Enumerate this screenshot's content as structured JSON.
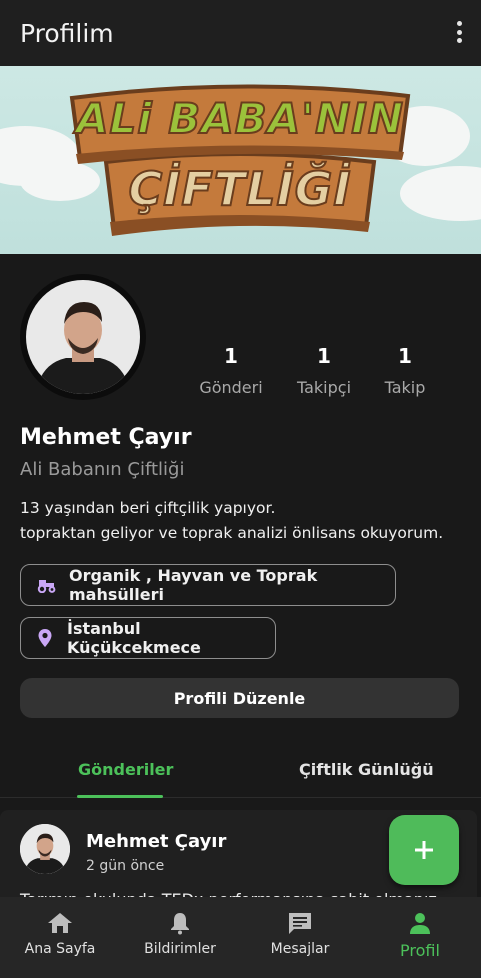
{
  "appbar": {
    "title": "Profilim"
  },
  "banner": {
    "line1": "ALi BABA'NIN",
    "line2": "ÇİFTLİĞİ"
  },
  "profile": {
    "name": "Mehmet Çayır",
    "farm": "Ali Babanın Çiftliği",
    "bio": "13 yaşından beri çiftçilik yapıyor.\ntopraktan geliyor ve toprak analizi önlisans okuyorum.",
    "stats": [
      {
        "value": "1",
        "label": "Gönderi"
      },
      {
        "value": "1",
        "label": "Takipçi"
      },
      {
        "value": "1",
        "label": "Takip"
      }
    ],
    "chips": [
      {
        "icon": "tractor-icon",
        "text": "Organik , Hayvan ve Toprak mahsülleri"
      },
      {
        "icon": "location-pin-icon",
        "text": "İstanbul Küçükcekmece"
      }
    ],
    "edit_label": "Profili Düzenle"
  },
  "tabs": [
    {
      "label": "Gönderiler",
      "active": true
    },
    {
      "label": "Çiftlik Günlüğü",
      "active": false
    }
  ],
  "post": {
    "author": "Mehmet Çayır",
    "time": "2 gün önce",
    "text": "Tarımın okulunda TEDx performansına şahit olmanız"
  },
  "fab": {
    "icon": "plus-icon"
  },
  "bottom_nav": [
    {
      "label": "Ana Sayfa",
      "icon": "home-icon",
      "active": false
    },
    {
      "label": "Bildirimler",
      "icon": "bell-icon",
      "active": false
    },
    {
      "label": "Mesajlar",
      "icon": "message-icon",
      "active": false
    },
    {
      "label": "Profil",
      "icon": "person-icon",
      "active": true
    }
  ],
  "colors": {
    "accent": "#4cc15a",
    "background": "#191919",
    "surface": "#202020"
  }
}
